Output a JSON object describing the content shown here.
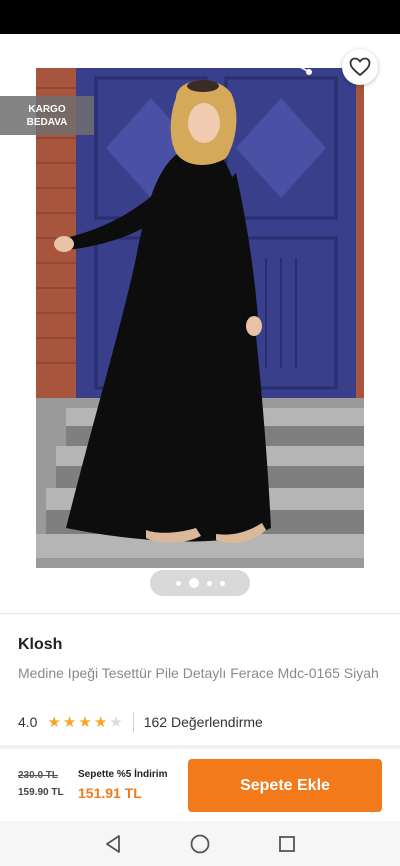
{
  "header": {
    "badge_line1": "KARGO",
    "badge_line2": "BEDAVA",
    "icons": [
      "back-arrow-icon",
      "share-icon",
      "heart-icon"
    ]
  },
  "gallery": {
    "image_description": "",
    "page_count": 4,
    "active_page": 2
  },
  "product": {
    "brand": "Klosh",
    "name": "Medine Ipeği Tesettür Pile Detaylı Ferace Mdc-0165 Siyah",
    "rating": "4.0",
    "stars_filled": 4,
    "stars_total": 5,
    "review_count_label": "162 Değerlendirme"
  },
  "pricing": {
    "old_price": "230.0 TL",
    "price": "159.90 TL",
    "discount_label": "Sepette %5 İndirim",
    "discount_price": "151.91 TL",
    "add_to_cart_label": "Sepete Ekle"
  },
  "colors": {
    "accent": "#f27a1a",
    "star": "#f6a623"
  },
  "navigation": {
    "icons": [
      "nav-back-icon",
      "nav-home-icon",
      "nav-recents-icon"
    ]
  }
}
